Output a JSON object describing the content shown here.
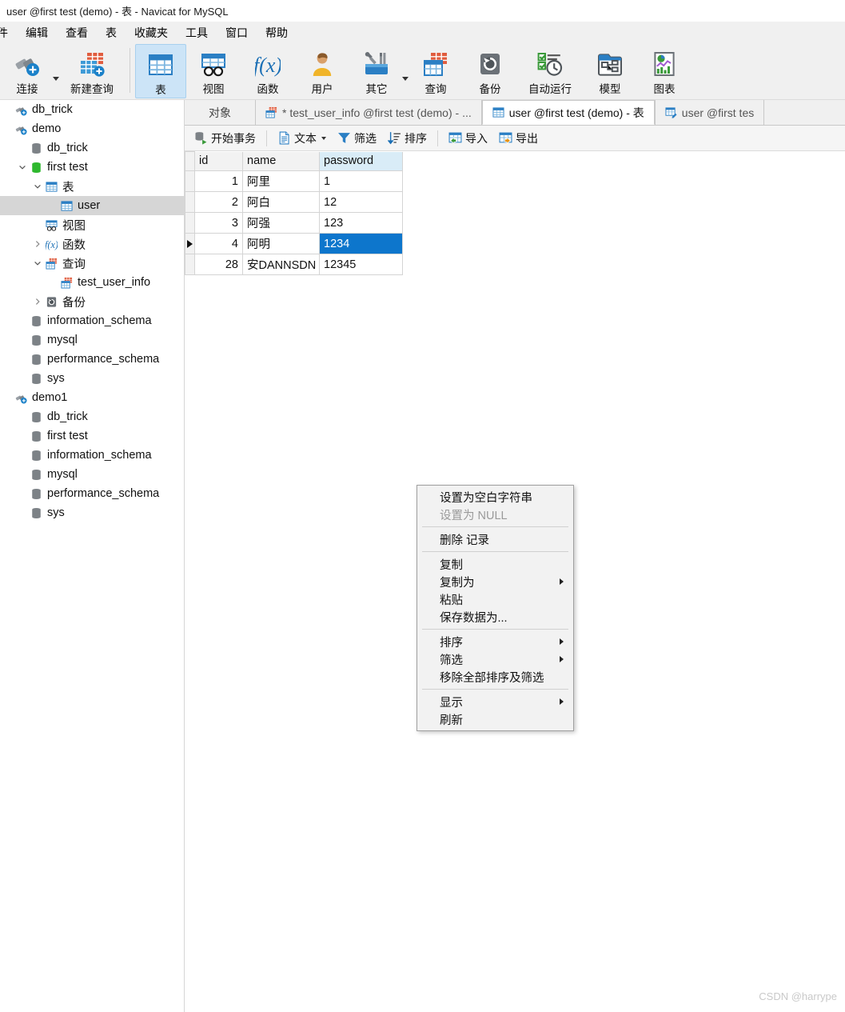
{
  "window": {
    "title": "user @first test (demo) - 表 - Navicat for MySQL"
  },
  "menubar": {
    "items": [
      {
        "label": "件",
        "name": "menu-file"
      },
      {
        "label": "编辑",
        "name": "menu-edit"
      },
      {
        "label": "查看",
        "name": "menu-view"
      },
      {
        "label": "表",
        "name": "menu-table"
      },
      {
        "label": "收藏夹",
        "name": "menu-favorites"
      },
      {
        "label": "工具",
        "name": "menu-tools"
      },
      {
        "label": "窗口",
        "name": "menu-window"
      },
      {
        "label": "帮助",
        "name": "menu-help"
      }
    ]
  },
  "toolbar": {
    "buttons": [
      {
        "label": "连接",
        "icon": "connection-icon",
        "active": false,
        "caret": true
      },
      {
        "label": "新建查询",
        "icon": "new-query-icon",
        "active": false,
        "caret": false
      },
      {
        "label": "表",
        "icon": "table-icon",
        "active": true,
        "caret": false
      },
      {
        "label": "视图",
        "icon": "view-icon",
        "active": false,
        "caret": false
      },
      {
        "label": "函数",
        "icon": "function-icon",
        "active": false,
        "caret": false
      },
      {
        "label": "用户",
        "icon": "user-icon",
        "active": false,
        "caret": false
      },
      {
        "label": "其它",
        "icon": "others-icon",
        "active": false,
        "caret": true
      },
      {
        "label": "查询",
        "icon": "query-icon",
        "active": false,
        "caret": false
      },
      {
        "label": "备份",
        "icon": "backup-icon",
        "active": false,
        "caret": false
      },
      {
        "label": "自动运行",
        "icon": "automation-icon",
        "active": false,
        "caret": false
      },
      {
        "label": "模型",
        "icon": "model-icon",
        "active": false,
        "caret": false
      },
      {
        "label": "图表",
        "icon": "chart-icon",
        "active": false,
        "caret": false
      }
    ]
  },
  "sidebar": {
    "items": [
      {
        "label": "db_trick",
        "icon": "connection-icon",
        "indent": 0,
        "chev": "",
        "selected": false
      },
      {
        "label": "demo",
        "icon": "connection-icon",
        "indent": 0,
        "chev": "",
        "selected": false
      },
      {
        "label": "db_trick",
        "icon": "database-icon",
        "indent": 1,
        "chev": "",
        "selected": false
      },
      {
        "label": "first test",
        "icon": "database-open-icon",
        "indent": 1,
        "chev": "v",
        "selected": false
      },
      {
        "label": "表",
        "icon": "table-icon",
        "indent": 2,
        "chev": "v",
        "selected": false
      },
      {
        "label": "user",
        "icon": "table-icon",
        "indent": 3,
        "chev": "",
        "selected": true
      },
      {
        "label": "视图",
        "icon": "view-icon",
        "indent": 2,
        "chev": "",
        "selected": false
      },
      {
        "label": "函数",
        "icon": "function-icon",
        "indent": 2,
        "chev": ">",
        "selected": false
      },
      {
        "label": "查询",
        "icon": "query-icon",
        "indent": 2,
        "chev": "v",
        "selected": false
      },
      {
        "label": "test_user_info",
        "icon": "query-icon",
        "indent": 3,
        "chev": "",
        "selected": false
      },
      {
        "label": "备份",
        "icon": "backup-icon",
        "indent": 2,
        "chev": ">",
        "selected": false
      },
      {
        "label": "information_schema",
        "icon": "database-icon",
        "indent": 1,
        "chev": "",
        "selected": false
      },
      {
        "label": "mysql",
        "icon": "database-icon",
        "indent": 1,
        "chev": "",
        "selected": false
      },
      {
        "label": "performance_schema",
        "icon": "database-icon",
        "indent": 1,
        "chev": "",
        "selected": false
      },
      {
        "label": "sys",
        "icon": "database-icon",
        "indent": 1,
        "chev": "",
        "selected": false
      },
      {
        "label": "demo1",
        "icon": "connection-icon",
        "indent": 0,
        "chev": "",
        "selected": false
      },
      {
        "label": "db_trick",
        "icon": "database-icon",
        "indent": 1,
        "chev": "",
        "selected": false
      },
      {
        "label": "first test",
        "icon": "database-icon",
        "indent": 1,
        "chev": "",
        "selected": false
      },
      {
        "label": "information_schema",
        "icon": "database-icon",
        "indent": 1,
        "chev": "",
        "selected": false
      },
      {
        "label": "mysql",
        "icon": "database-icon",
        "indent": 1,
        "chev": "",
        "selected": false
      },
      {
        "label": "performance_schema",
        "icon": "database-icon",
        "indent": 1,
        "chev": "",
        "selected": false
      },
      {
        "label": "sys",
        "icon": "database-icon",
        "indent": 1,
        "chev": "",
        "selected": false
      }
    ]
  },
  "tabbar": {
    "object_label": "对象",
    "tabs": [
      {
        "label": "* test_user_info @first test (demo) - ...",
        "icon": "query-icon",
        "active": false
      },
      {
        "label": "user @first test (demo) - 表",
        "icon": "table-icon",
        "active": true
      },
      {
        "label": "user @first tes",
        "icon": "table-design-icon",
        "active": false
      }
    ]
  },
  "gridbar": {
    "buttons": [
      {
        "label": "开始事务",
        "icon": "transaction-icon",
        "caret": false
      },
      {
        "label": "文本",
        "icon": "text-icon",
        "caret": true
      },
      {
        "label": "筛选",
        "icon": "filter-icon",
        "caret": false
      },
      {
        "label": "排序",
        "icon": "sort-icon",
        "caret": false
      },
      {
        "label": "导入",
        "icon": "import-icon",
        "caret": false
      },
      {
        "label": "导出",
        "icon": "export-icon",
        "caret": false
      }
    ]
  },
  "grid": {
    "columns": [
      "id",
      "name",
      "password"
    ],
    "selected_column": "password",
    "selected_row_index": 3,
    "selected_cell": {
      "row": 3,
      "column": "password",
      "value": "1234"
    },
    "rows": [
      {
        "id": "1",
        "name": "阿里",
        "password": "1"
      },
      {
        "id": "2",
        "name": "阿白",
        "password": "12"
      },
      {
        "id": "3",
        "name": "阿强",
        "password": "123"
      },
      {
        "id": "4",
        "name": "阿明",
        "password": "1234"
      },
      {
        "id": "28",
        "name": "安DANNSDN",
        "password": "12345"
      }
    ]
  },
  "context_menu": {
    "items": [
      {
        "label": "设置为空白字符串",
        "submenu": false,
        "disabled": false
      },
      {
        "label": "设置为 NULL",
        "submenu": false,
        "disabled": true
      },
      {
        "separator": true
      },
      {
        "label": "删除 记录",
        "submenu": false,
        "disabled": false
      },
      {
        "separator": true
      },
      {
        "label": "复制",
        "submenu": false,
        "disabled": false
      },
      {
        "label": "复制为",
        "submenu": true,
        "disabled": false
      },
      {
        "label": "粘贴",
        "submenu": false,
        "disabled": false
      },
      {
        "label": "保存数据为...",
        "submenu": false,
        "disabled": false
      },
      {
        "separator": true
      },
      {
        "label": "排序",
        "submenu": true,
        "disabled": false
      },
      {
        "label": "筛选",
        "submenu": true,
        "disabled": false
      },
      {
        "label": "移除全部排序及筛选",
        "submenu": false,
        "disabled": false
      },
      {
        "separator": true
      },
      {
        "label": "显示",
        "submenu": true,
        "disabled": false
      },
      {
        "label": "刷新",
        "submenu": false,
        "disabled": false
      }
    ]
  },
  "watermark": {
    "text": "CSDN @harrype"
  },
  "colors": {
    "accent_blue": "#0d76cc",
    "selection_light_blue": "#cce4f7",
    "column_header_selected": "#d9ecf7",
    "tree_selected": "#d6d6d6",
    "toolbar_bg": "#f0f0f0",
    "db_green": "#2eb82e"
  }
}
